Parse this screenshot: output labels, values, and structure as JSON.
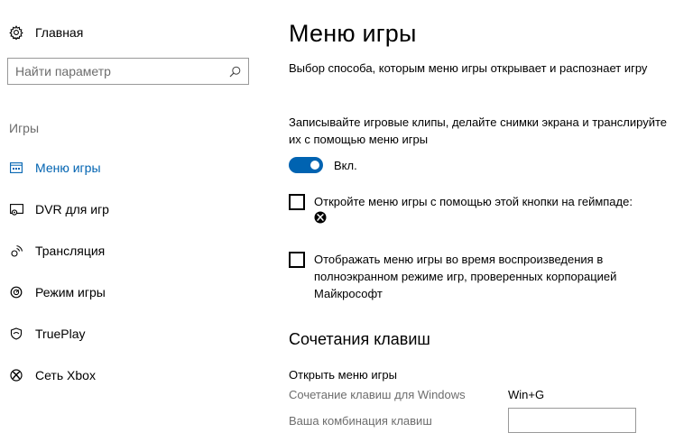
{
  "sidebar": {
    "home_label": "Главная",
    "search_placeholder": "Найти параметр",
    "section_label": "Игры",
    "items": [
      {
        "label": "Меню игры",
        "icon": "game-bar-icon",
        "active": true
      },
      {
        "label": "DVR для игр",
        "icon": "game-dvr-icon",
        "active": false
      },
      {
        "label": "Трансляция",
        "icon": "broadcast-icon",
        "active": false
      },
      {
        "label": "Режим игры",
        "icon": "game-mode-icon",
        "active": false
      },
      {
        "label": "TruePlay",
        "icon": "trueplay-icon",
        "active": false
      },
      {
        "label": "Сеть Xbox",
        "icon": "xbox-icon",
        "active": false
      }
    ]
  },
  "main": {
    "title": "Меню игры",
    "description": "Выбор способа, которым меню игры открывает и распознает игру",
    "record_description": "Записывайте игровые клипы, делайте снимки экрана и транслируйте их с помощью меню игры",
    "toggle": {
      "state": "on",
      "label": "Вкл."
    },
    "checkbox_gamepad": {
      "label": "Откройте меню игры с помощью этой кнопки на геймпаде:",
      "checked": false
    },
    "checkbox_fullscreen": {
      "label": "Отображать меню игры во время воспроизведения в полноэкранном режиме игр, проверенных корпорацией Майкрософт",
      "checked": false
    },
    "shortcuts": {
      "heading": "Сочетания клавиш",
      "open_menu_title": "Открыть меню игры",
      "windows_label": "Сочетание клавиш для Windows",
      "windows_value": "Win+G",
      "custom_label": "Ваша комбинация клавиш",
      "custom_value": ""
    }
  },
  "colors": {
    "accent": "#0063b1",
    "secondary_text": "#6d6d6d",
    "border": "#999999"
  }
}
